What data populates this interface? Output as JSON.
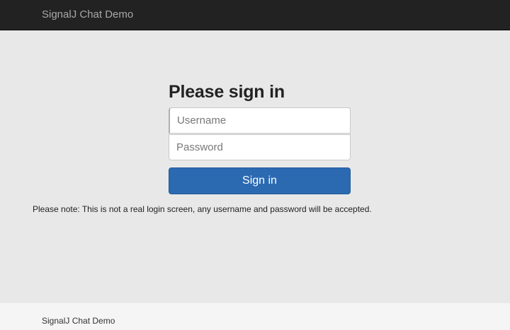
{
  "navbar": {
    "brand": "SignalJ Chat Demo"
  },
  "form": {
    "heading": "Please sign in",
    "username_placeholder": "Username",
    "username_value": "",
    "password_placeholder": "Password",
    "password_value": "",
    "submit_label": "Sign in"
  },
  "note": "Please note: This is not a real login screen, any username and password will be accepted.",
  "footer": {
    "text": "SignalJ Chat Demo"
  },
  "colors": {
    "navbar_bg": "#222222",
    "page_bg": "#e8e8e8",
    "primary_button": "#2b6ab1",
    "footer_bg": "#f5f5f5"
  }
}
